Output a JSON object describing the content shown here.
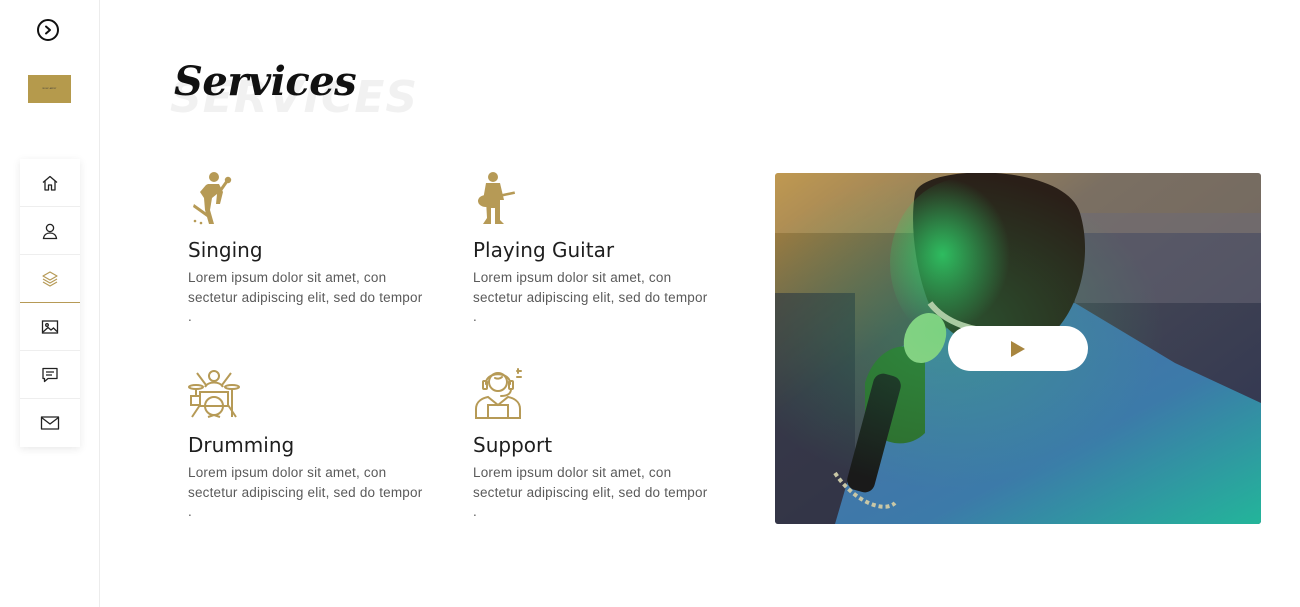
{
  "logo": {
    "text": "MUSIC ARTIST"
  },
  "nav": {
    "items": [
      {
        "name": "home",
        "icon": "home-icon"
      },
      {
        "name": "about",
        "icon": "user-icon"
      },
      {
        "name": "services",
        "icon": "layers-icon",
        "active": true
      },
      {
        "name": "gallery",
        "icon": "image-icon"
      },
      {
        "name": "testimonials",
        "icon": "message-icon"
      },
      {
        "name": "contact",
        "icon": "mail-icon"
      }
    ]
  },
  "section": {
    "title": "Services",
    "title_shadow": "SERVICES"
  },
  "services": [
    {
      "icon": "singer-icon",
      "title": "Singing",
      "text": "Lorem ipsum dolor sit amet, con sectetur adipiscing elit, sed do tempor ."
    },
    {
      "icon": "guitar-player-icon",
      "title": "Playing Guitar",
      "text": "Lorem ipsum dolor sit amet, con sectetur adipiscing elit, sed do tempor ."
    },
    {
      "icon": "drummer-icon",
      "title": "Drumming",
      "text": "Lorem ipsum dolor sit amet, con sectetur adipiscing elit, sed do tempor ."
    },
    {
      "icon": "support-icon",
      "title": "Support",
      "text": "Lorem ipsum dolor sit amet, con sectetur adipiscing elit, sed do tempor ."
    }
  ],
  "colors": {
    "accent": "#b69a56",
    "text": "#1e1e1e",
    "muted": "#5a5a5a"
  },
  "video": {
    "play_icon": "play-icon"
  }
}
